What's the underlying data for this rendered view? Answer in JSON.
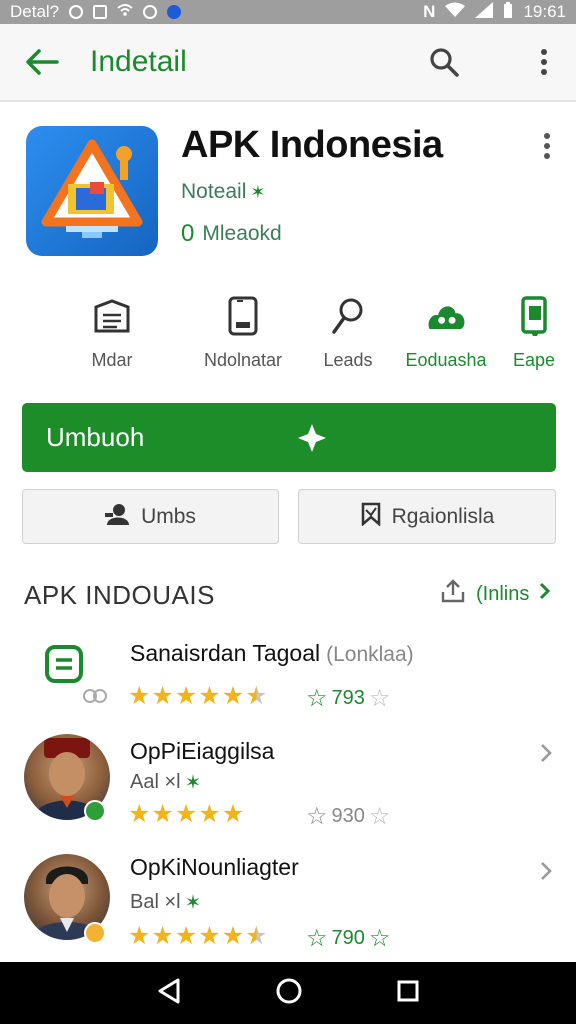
{
  "status_bar": {
    "left_text": "Detal?",
    "time": "19:61"
  },
  "app_bar": {
    "title": "Indetail",
    "back_icon": "arrow-left-icon",
    "search_icon": "search-icon",
    "more_icon": "more-vert-icon",
    "accent_color": "#1b8a2e"
  },
  "app": {
    "name": "APK Indonesia",
    "developer": "Noteail",
    "downloads_value": "0",
    "downloads_label": "Mleaokd",
    "icon": "warning-triangle-monitor-icon"
  },
  "categories": [
    {
      "label": "Mdar",
      "icon": "document-stack-icon"
    },
    {
      "label": "Ndolnatar",
      "icon": "phone-icon"
    },
    {
      "label": "Leads",
      "icon": "key-icon"
    },
    {
      "label": "Eoduasha",
      "icon": "cloud-group-icon"
    },
    {
      "label": "Eape",
      "icon": "phone-share-icon"
    }
  ],
  "install_button": {
    "label": "Umbuoh",
    "color": "#1d8d2a"
  },
  "secondary_buttons": [
    {
      "label": "Umbs",
      "icon": "user-icon"
    },
    {
      "label": "Rgaionlisla",
      "icon": "bookmark-icon"
    }
  ],
  "section": {
    "title": "APK INDOUAIS",
    "link_label": "(Inlins",
    "share_icon": "share-icon"
  },
  "reviews": [
    {
      "name": "Sanaisrdan Tagoal",
      "tag": "(Lonklaa)",
      "sub": "",
      "rating": 4.5,
      "count": "793",
      "avatar": "doc-icon"
    },
    {
      "name": "OpPiEiaggilsa",
      "tag": "",
      "sub": "Aal ×l",
      "rating": 5,
      "count": "930",
      "avatar": "user-photo"
    },
    {
      "name": "OpKiNounliagter",
      "tag": "",
      "sub": "Bal ×l",
      "rating": 4.5,
      "count": "790",
      "avatar": "user-photo"
    }
  ],
  "nav_bar": {
    "back_icon": "nav-back-icon",
    "home_icon": "nav-home-icon",
    "recents_icon": "nav-recents-icon"
  }
}
